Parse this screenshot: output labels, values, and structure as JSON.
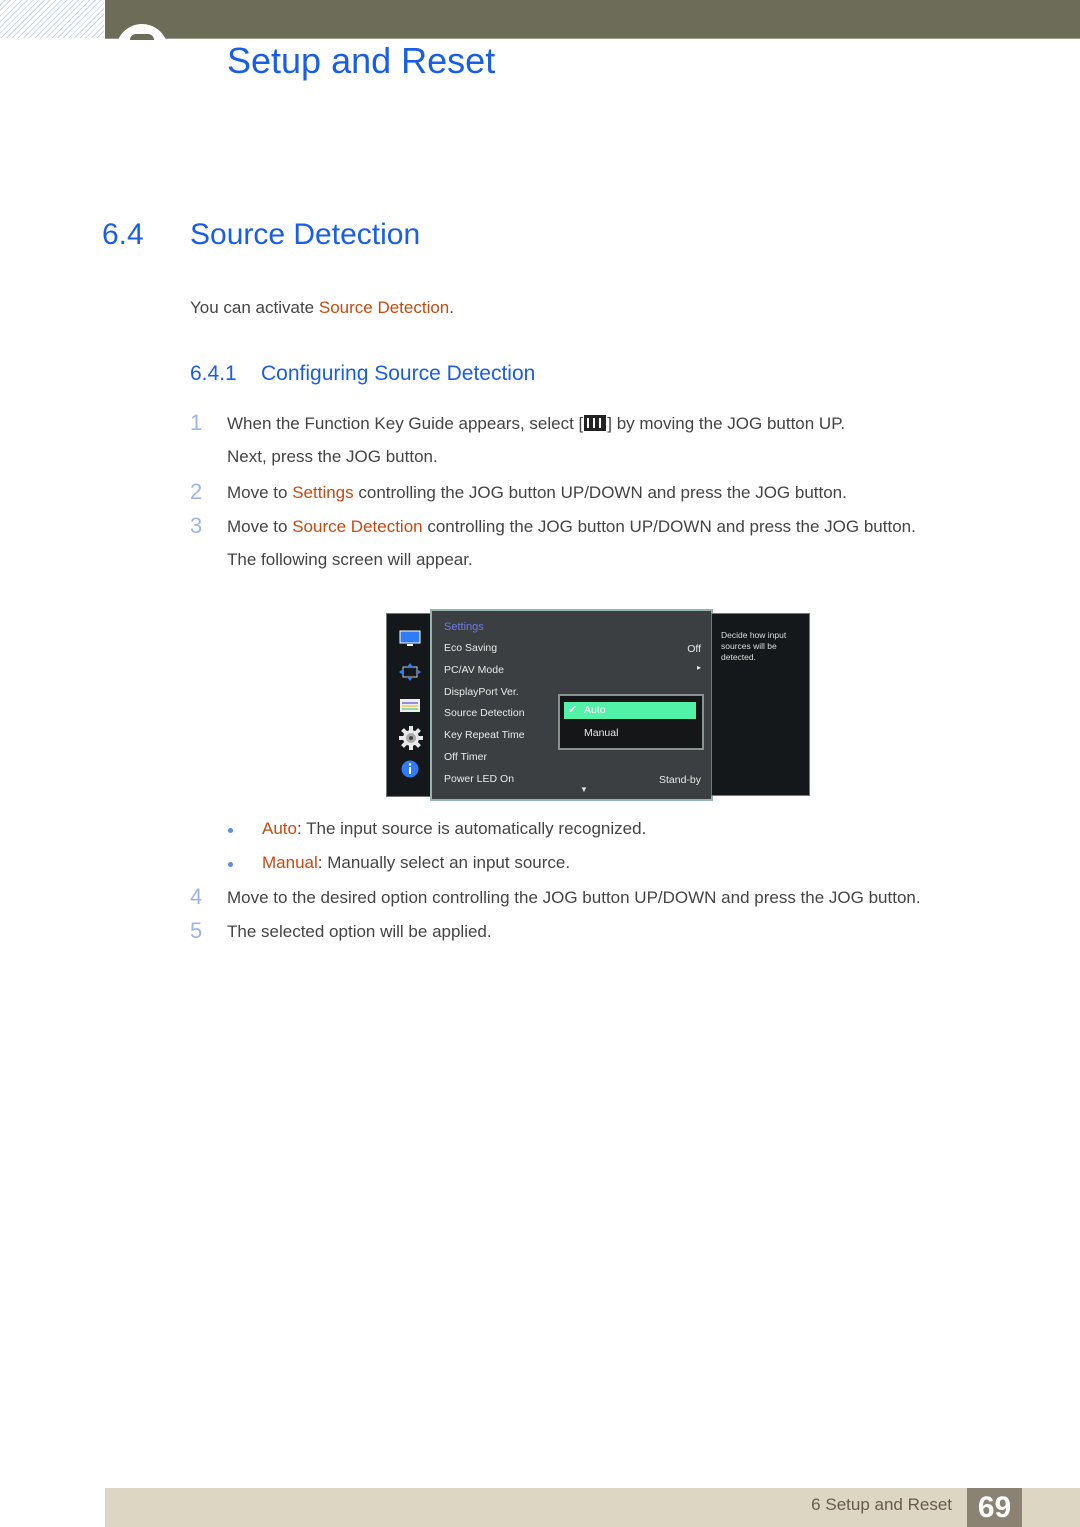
{
  "header": {
    "chapter_title": "Setup and Reset"
  },
  "section": {
    "number": "6.4",
    "title": "Source Detection",
    "intro_prefix": "You can activate ",
    "intro_highlight": "Source Detection",
    "intro_suffix": "."
  },
  "subsection": {
    "number": "6.4.1",
    "title": "Configuring Source Detection"
  },
  "steps": [
    {
      "num": "1",
      "line1_pre": "When the Function Key Guide appears, select [",
      "icon": "menu-icon",
      "line1_post": "] by moving the JOG button UP.",
      "line2": "Next, press the JOG button."
    },
    {
      "num": "2",
      "pre": "Move to ",
      "highlight": "Settings",
      "post": " controlling the JOG button UP/DOWN and press the JOG button."
    },
    {
      "num": "3",
      "pre": "Move to ",
      "highlight": "Source Detection",
      "post": " controlling the JOG button UP/DOWN and press the JOG button.",
      "line2": "The following screen will appear."
    },
    {
      "num": "4",
      "text": "Move to the desired option controlling the JOG button UP/DOWN and press the JOG button."
    },
    {
      "num": "5",
      "text": "The selected option will be applied."
    }
  ],
  "osd": {
    "sidebar_icons": [
      "monitor-icon",
      "size-position-icon",
      "picture-settings-icon",
      "gear-icon",
      "info-icon"
    ],
    "menu_title": "Settings",
    "rows": [
      {
        "label": "Eco Saving",
        "value": "Off"
      },
      {
        "label": "PC/AV Mode",
        "value": "▸"
      },
      {
        "label": "DisplayPort Ver.",
        "value": ""
      },
      {
        "label": "Source Detection",
        "value": ""
      },
      {
        "label": "Key Repeat Time",
        "value": ""
      },
      {
        "label": "Off Timer",
        "value": ""
      },
      {
        "label": "Power LED On",
        "value": "Stand-by"
      }
    ],
    "popup_options": [
      {
        "label": "Auto",
        "selected": true
      },
      {
        "label": "Manual",
        "selected": false
      }
    ],
    "description": "Decide how input sources will be detected.",
    "highlight_color": "#52f3a8"
  },
  "bullets": [
    {
      "term": "Auto",
      "text": ": The input source is automatically recognized."
    },
    {
      "term": "Manual",
      "text": ": Manually select an input source."
    }
  ],
  "footer": {
    "chapter": "6 Setup and Reset",
    "page": "69"
  }
}
